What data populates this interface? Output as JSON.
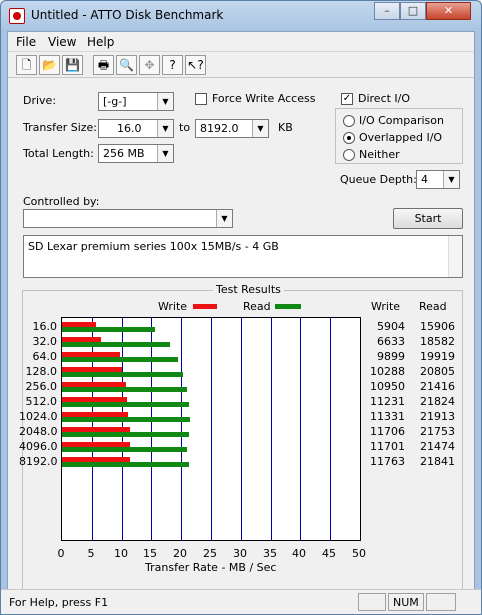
{
  "window": {
    "title": "Untitled - ATTO Disk Benchmark",
    "minimize": "–",
    "maximize": "□",
    "close": "✕"
  },
  "menu": {
    "file": "File",
    "view": "View",
    "help": "Help"
  },
  "form": {
    "drive_label": "Drive:",
    "drive_value": "[-g-]",
    "force_write_label": "Force Write Access",
    "direct_io_label": "Direct I/O",
    "transfer_size_label": "Transfer Size:",
    "transfer_from": "16.0",
    "to_label": "to",
    "transfer_to": "8192.0",
    "kb_label": "KB",
    "total_length_label": "Total Length:",
    "total_length_value": "256 MB",
    "io_comparison_label": "I/O Comparison",
    "overlapped_io_label": "Overlapped I/O",
    "neither_label": "Neither",
    "queue_depth_label": "Queue Depth:",
    "queue_depth_value": "4",
    "controlled_by_label": "Controlled by:",
    "controlled_by_value": "",
    "start_label": "Start",
    "description": "SD Lexar premium series 100x 15MB/s - 4 GB"
  },
  "results": {
    "title": "Test Results",
    "write_legend": "Write",
    "read_legend": "Read",
    "write_header": "Write",
    "read_header": "Read",
    "xlabel": "Transfer Rate - MB / Sec",
    "write_color": "#ee1111",
    "read_color": "#118811"
  },
  "chart_data": {
    "type": "bar",
    "categories": [
      "16.0",
      "32.0",
      "64.0",
      "128.0",
      "256.0",
      "512.0",
      "1024.0",
      "2048.0",
      "4096.0",
      "8192.0"
    ],
    "series": [
      {
        "name": "Write",
        "values": [
          5904,
          6633,
          9899,
          10288,
          10950,
          11231,
          11331,
          11706,
          11701,
          11763
        ]
      },
      {
        "name": "Read",
        "values": [
          15906,
          18582,
          19919,
          20805,
          21416,
          21824,
          21913,
          21753,
          21474,
          21841
        ]
      }
    ],
    "write_text": [
      "5904",
      "6633",
      "9899",
      "10288",
      "10950",
      "11231",
      "11331",
      "11706",
      "11701",
      "11763"
    ],
    "read_text": [
      "15906",
      "18582",
      "19919",
      "20805",
      "21416",
      "21824",
      "21913",
      "21753",
      "21474",
      "21841"
    ],
    "xticks": [
      "0",
      "5",
      "10",
      "15",
      "20",
      "25",
      "30",
      "35",
      "40",
      "45",
      "50"
    ],
    "xlim": [
      0,
      50
    ],
    "xlabel": "Transfer Rate - MB / Sec"
  },
  "statusbar": {
    "help": "For Help, press F1",
    "num": "NUM"
  }
}
